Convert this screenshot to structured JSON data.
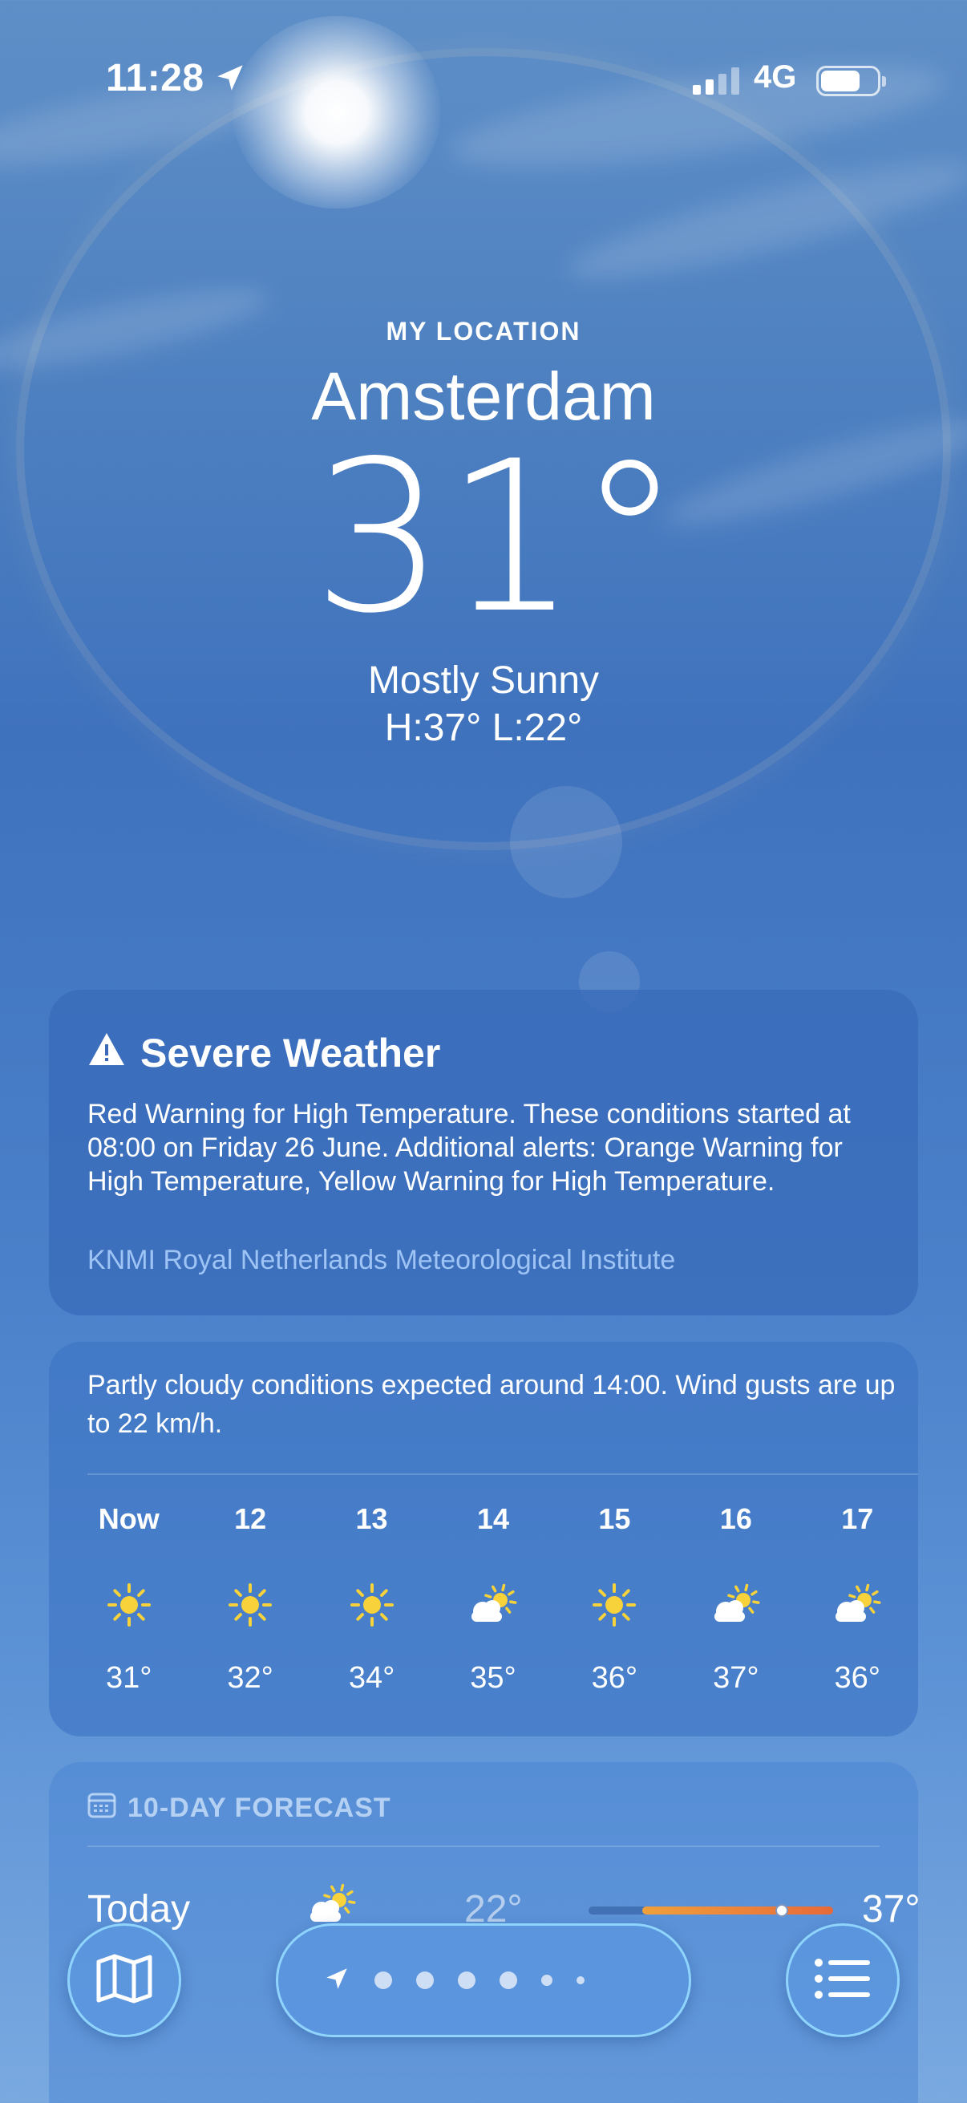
{
  "status_bar": {
    "time": "11:28",
    "network": "4G",
    "icons": [
      "location-arrow-icon",
      "signal-icon",
      "battery-icon"
    ]
  },
  "header": {
    "label": "MY LOCATION",
    "city": "Amsterdam",
    "temperature": "31°",
    "condition": "Mostly Sunny",
    "high_low": "H:37°  L:22°"
  },
  "alert": {
    "title": "Severe Weather",
    "icon": "warning-icon",
    "body": "Red Warning for High Temperature. These conditions started at 08:00 on Friday 26 June. Additional alerts: Orange Warning for High Temperature, Yellow Warning for High Temperature.",
    "source": "KNMI Royal Netherlands Meteorological Institute"
  },
  "hourly": {
    "summary": "Partly cloudy conditions expected around 14:00. Wind gusts are up to 22 km/h.",
    "hours": [
      {
        "label": "Now",
        "icon": "sun-icon",
        "temp": "31°"
      },
      {
        "label": "12",
        "icon": "sun-icon",
        "temp": "32°"
      },
      {
        "label": "13",
        "icon": "sun-icon",
        "temp": "34°"
      },
      {
        "label": "14",
        "icon": "partly-cloudy-icon",
        "temp": "35°"
      },
      {
        "label": "15",
        "icon": "sun-icon",
        "temp": "36°"
      },
      {
        "label": "16",
        "icon": "partly-cloudy-icon",
        "temp": "37°"
      },
      {
        "label": "17",
        "icon": "partly-cloudy-icon",
        "temp": "36°"
      }
    ]
  },
  "ten_day": {
    "title": "10-DAY FORECAST",
    "icon": "calendar-icon",
    "days": [
      {
        "name": "Today",
        "icon": "partly-cloudy-icon",
        "low": "22°",
        "high": "37°",
        "current_fraction": 0.6
      }
    ]
  },
  "bottom_bar": {
    "map_icon": "map-icon",
    "list_icon": "list-icon",
    "page_count": 7,
    "active_page": 0
  },
  "colors": {
    "sun": "#f7d23a",
    "source_link": "#9ec3f5",
    "bar_start": "#f0a03c",
    "bar_end": "#e86a3a"
  }
}
